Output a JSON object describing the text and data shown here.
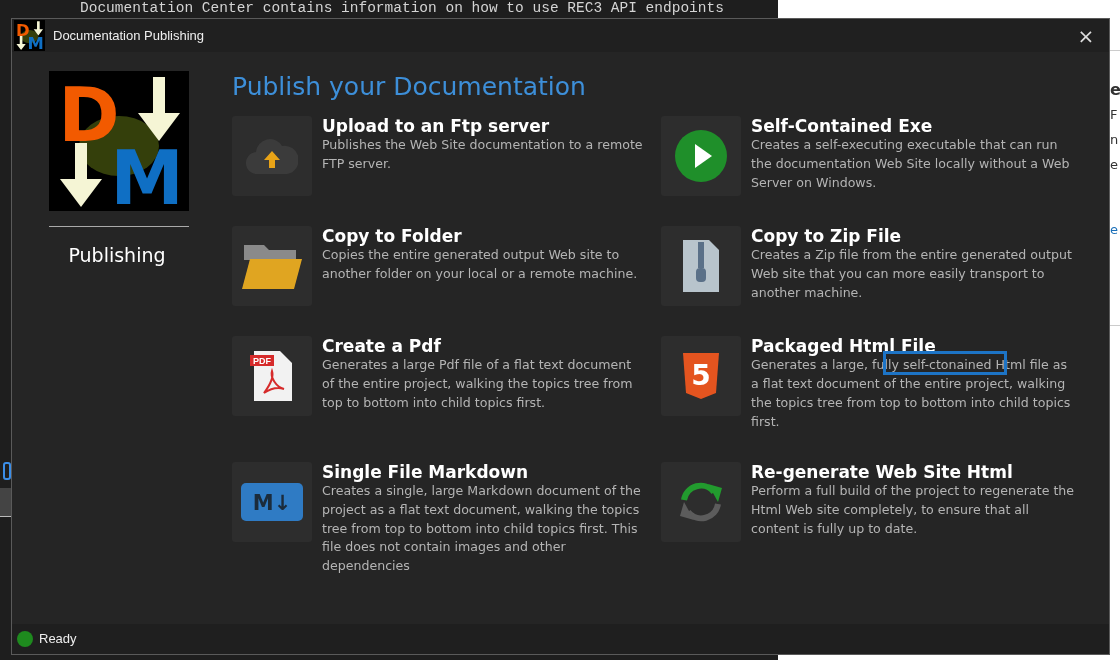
{
  "background": {
    "editor_line": "Documentation Center contains information on how to use REC3 API endpoints",
    "side_fragments": [
      "e",
      "F",
      "n",
      "e",
      "e"
    ]
  },
  "window": {
    "title": "Documentation Publishing",
    "icon_letters": [
      "D",
      "M"
    ],
    "close": "×"
  },
  "sidebar": {
    "logo_letters": [
      "D",
      "M"
    ],
    "label": "Publishing"
  },
  "heading": "Publish your Documentation",
  "options": [
    {
      "kind": "upload",
      "title": "Upload to an Ftp server",
      "description": "Publishes the Web Site documentation to a remote FTP server."
    },
    {
      "kind": "exe",
      "title": "Self-Contained Exe",
      "description": "Creates a self-executing executable that can run the documentation Web Site locally without a Web Server on Windows."
    },
    {
      "kind": "folder",
      "title": "Copy to Folder",
      "description": "Copies the entire generated output Web site to another folder on your local or a remote machine."
    },
    {
      "kind": "zip",
      "title": "Copy to Zip File",
      "description": "Creates a Zip file from the entire generated output Web site that you can more easily transport to another machine."
    },
    {
      "kind": "pdf",
      "title": "Create a Pdf",
      "description": "Generates a large Pdf file of a flat text document of the entire project, walking the topics tree from top to bottom into child topics first.",
      "icon_text": "PDF"
    },
    {
      "kind": "html",
      "title": "Packaged Html File",
      "description": "Generates a large, fully self-ctonained Html file as a flat text document of the entire project, walking the topics tree from top to bottom into child topics first.",
      "icon_text": "5",
      "highlighted": true
    },
    {
      "kind": "markdown",
      "title": "Single File Markdown",
      "description": "Creates a single, large Markdown document of the project as a flat text document, walking the topics tree from top to bottom into child topics first. This file does not contain images and other dependencies",
      "icon_text": "M↓"
    },
    {
      "kind": "refresh",
      "title": "Re-generate Web Site Html",
      "description": "Perform a full build of the project to regenerate the Html Web site completely, to ensure that all content is fully up to date."
    }
  ],
  "status_bar": {
    "text": "Ready",
    "color": "#1e8a1e"
  }
}
